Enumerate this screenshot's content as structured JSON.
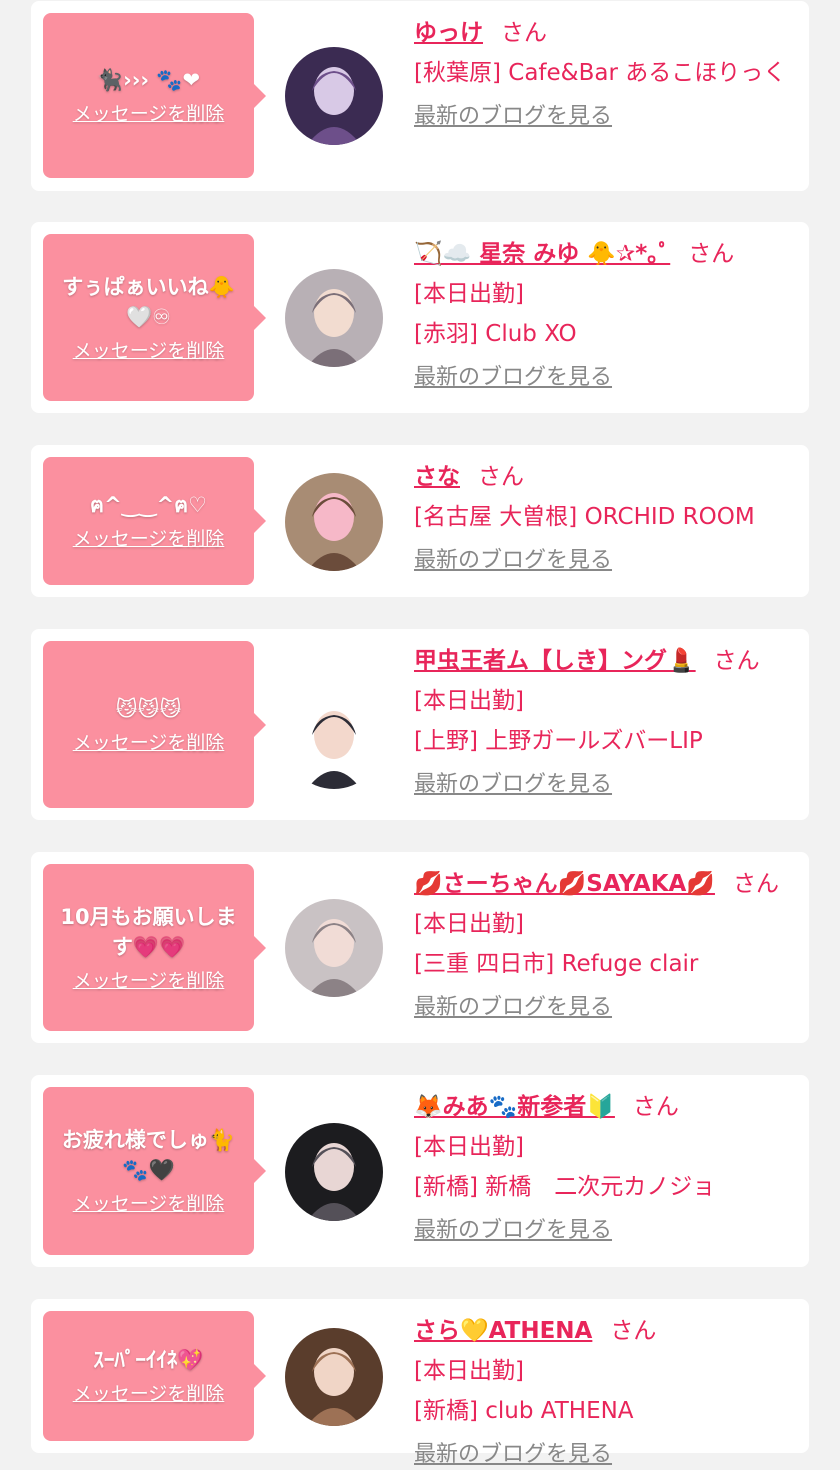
{
  "cards": [
    {
      "message": "🐈‍⬛",
      "message_tail": "››› 🐾❤",
      "delete_label": "メッセージを削除",
      "name": "ゆっけ",
      "honorific": "さん",
      "lines": [
        "[秋葉原] Cafe&Bar あるこほりっく"
      ],
      "blog_label": "最新のブログを見る",
      "avatar_colors": [
        "#3b2b52",
        "#d8c9e6",
        "#6d4f8a"
      ]
    },
    {
      "message": "すぅぱぁいいね🐥🤍♾",
      "message_tail": "",
      "delete_label": "メッセージを削除",
      "name": "🏹☁️ 星奈 みゆ 🐥✰*｡ﾟ",
      "honorific": "さん",
      "lines": [
        "[本日出勤]",
        "[赤羽] Club XO"
      ],
      "blog_label": "最新のブログを見る",
      "avatar_colors": [
        "#b8b0b5",
        "#f2dcd0",
        "#7b6f78"
      ]
    },
    {
      "message": "ฅ^‿‿^ฅ♡",
      "message_tail": "",
      "delete_label": "メッセージを削除",
      "name": "さな",
      "honorific": "さん",
      "lines": [
        "[名古屋 大曽根] ORCHID ROOM"
      ],
      "blog_label": "最新のブログを見る",
      "avatar_colors": [
        "#a88c74",
        "#f6b8c8",
        "#6b4c3b"
      ]
    },
    {
      "message": "😼😼😼",
      "message_tail": "",
      "delete_label": "メッセージを削除",
      "name": "甲虫王者ム【しき】ング💄",
      "honorific": "さん",
      "lines": [
        "[本日出勤]",
        "[上野] 上野ガールズバーLIP"
      ],
      "blog_label": "最新のブログを見る",
      "avatar_colors": [
        "#ffffff",
        "#f3d8cc",
        "#2c2c36"
      ]
    },
    {
      "message": "10月もお願いします💗💗",
      "message_tail": "",
      "delete_label": "メッセージを削除",
      "name": "💋さーちゃん💋SAYAKA💋",
      "honorific": "さん",
      "lines": [
        "[本日出勤]",
        "[三重 四日市] Refuge clair"
      ],
      "blog_label": "最新のブログを見る",
      "avatar_colors": [
        "#c9c2c4",
        "#f1dcd6",
        "#8c8286"
      ]
    },
    {
      "message": "お疲れ様でしゅ🐈🐾🖤",
      "message_tail": "",
      "delete_label": "メッセージを削除",
      "name": "🦊みあ🐾新参者🔰",
      "honorific": "さん",
      "lines": [
        "[本日出勤]",
        "[新橋] 新橋　二次元カノジョ"
      ],
      "blog_label": "最新のブログを見る",
      "avatar_colors": [
        "#1c1c1f",
        "#e8d6d4",
        "#545058"
      ]
    },
    {
      "message": "ｽｰﾊﾟｰｲｲﾈ💖",
      "message_tail": "",
      "delete_label": "メッセージを削除",
      "name": "さら💛ATHENA",
      "honorific": "さん",
      "lines": [
        "[本日出勤]",
        "[新橋] club ATHENA"
      ],
      "blog_label": "最新のブログを見る",
      "avatar_colors": [
        "#5a3d2c",
        "#f0d5c6",
        "#9d7155"
      ]
    }
  ]
}
